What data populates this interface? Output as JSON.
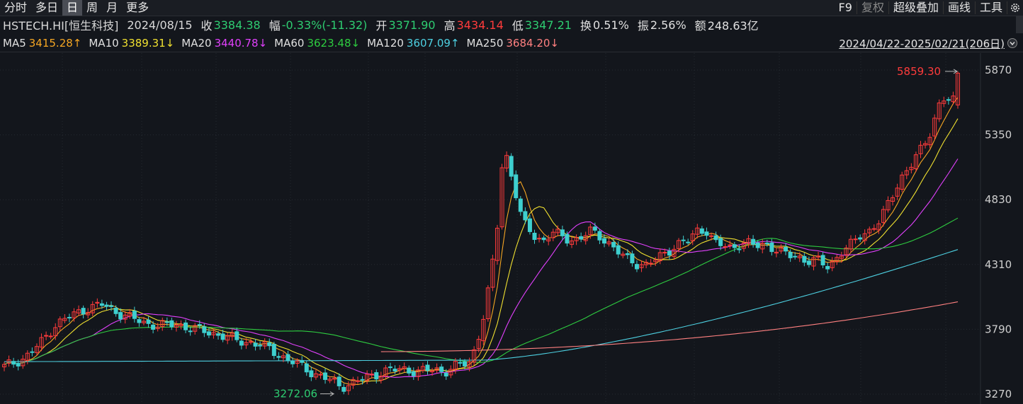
{
  "toolbar": {
    "tabs": [
      "分时",
      "多日",
      "日",
      "周",
      "月",
      "更多"
    ],
    "active_tab": "日",
    "tools": [
      "F9",
      "复权",
      "超级叠加",
      "画线",
      "工具"
    ]
  },
  "info": {
    "symbol": "HSTECH.HI[恒生科技]",
    "date": "2024/08/15",
    "close_label": "收",
    "close": "3384.38",
    "chg_label": "幅",
    "chg": "-0.33%(-11.32)",
    "open_label": "开",
    "open": "3371.90",
    "high_label": "高",
    "high": "3434.14",
    "low_label": "低",
    "low": "3347.21",
    "turnover_label": "换",
    "turnover": "0.51%",
    "amp_label": "振",
    "amp": "2.56%",
    "amount_label": "额",
    "amount": "248.63亿"
  },
  "ma": [
    {
      "name": "MA5",
      "value": "3415.28↑",
      "color": "#f5a623"
    },
    {
      "name": "MA10",
      "value": "3389.31↓",
      "color": "#f0e030"
    },
    {
      "name": "MA20",
      "value": "3440.78↓",
      "color": "#e040fb"
    },
    {
      "name": "MA60",
      "value": "3623.48↓",
      "color": "#2ecc40"
    },
    {
      "name": "MA120",
      "value": "3607.09↑",
      "color": "#4dd0e1"
    },
    {
      "name": "MA250",
      "value": "3684.20↓",
      "color": "#ff8080"
    }
  ],
  "range_text": "2024/04/22-2025/02/21(206日)",
  "chart_data": {
    "type": "candlestick",
    "ylim": [
      3270,
      5870
    ],
    "y_ticks": [
      "5870",
      "5350",
      "4830",
      "4310",
      "3790",
      "3270"
    ],
    "max_label": "5859.30",
    "min_label": "3272.06",
    "candle_count": 206,
    "colors": {
      "up": "#ff3b3b",
      "down": "#3ecfcf"
    }
  }
}
